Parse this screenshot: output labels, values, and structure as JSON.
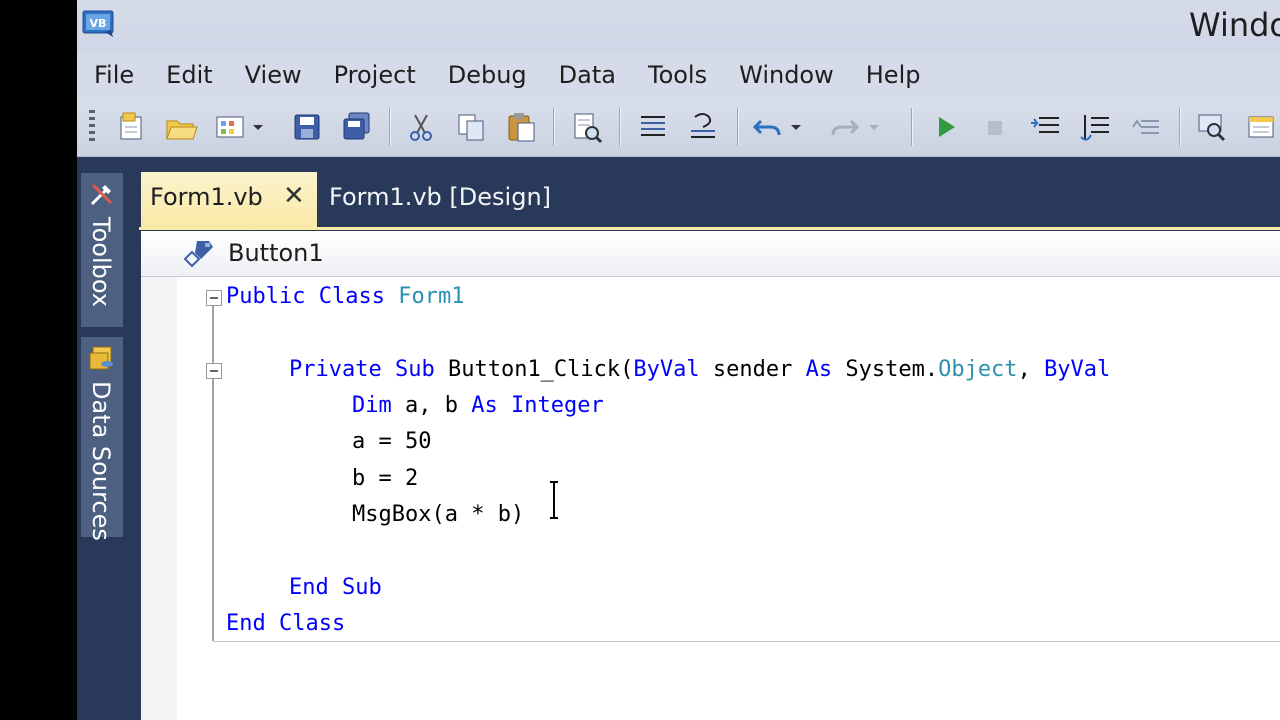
{
  "window": {
    "title": "Windo"
  },
  "menu": [
    "File",
    "Edit",
    "View",
    "Project",
    "Debug",
    "Data",
    "Tools",
    "Window",
    "Help"
  ],
  "toolbar_icons": [
    "new-project-icon",
    "open-file-icon",
    "add-item-icon",
    "save-icon",
    "save-all-icon",
    "cut-icon",
    "copy-icon",
    "paste-icon",
    "find-icon",
    "indent-icon",
    "comment-icon",
    "undo-icon",
    "redo-icon",
    "start-debugging-icon",
    "stop-debugging-icon",
    "step-into-icon",
    "step-over-icon",
    "step-out-icon",
    "solution-explorer-icon",
    "properties-icon"
  ],
  "side_tabs": {
    "toolbox": "Toolbox",
    "data_sources": "Data Sources"
  },
  "tabs": {
    "active": "Form1.vb",
    "close_glyph": "✕",
    "inactive": "Form1.vb [Design]"
  },
  "navbar": {
    "member": "Button1"
  },
  "code": {
    "line1": {
      "kw1": "Public",
      "kw2": "Class",
      "type": "Form1"
    },
    "line3": {
      "kw1": "Private",
      "kw2": "Sub",
      "name": "Button1_Click(",
      "kw3": "ByVal",
      "mid": " sender ",
      "kw4": "As",
      "ns": " System.",
      "type": "Object",
      "sep": ", ",
      "kw5": "ByVal"
    },
    "line4": {
      "kw1": "Dim",
      "vars": " a, b ",
      "kw2": "As",
      "type": "Integer"
    },
    "line5": "a = 50",
    "line6": "b = 2",
    "line7": "MsgBox(a * b)",
    "line9": {
      "kw1": "End",
      "kw2": "Sub"
    },
    "line10": {
      "kw1": "End",
      "kw2": "Class"
    }
  },
  "colors": {
    "keyword": "#0000ff",
    "type": "#2b91af",
    "chrome": "#29395a",
    "active_tab": "#f9e9a7"
  }
}
